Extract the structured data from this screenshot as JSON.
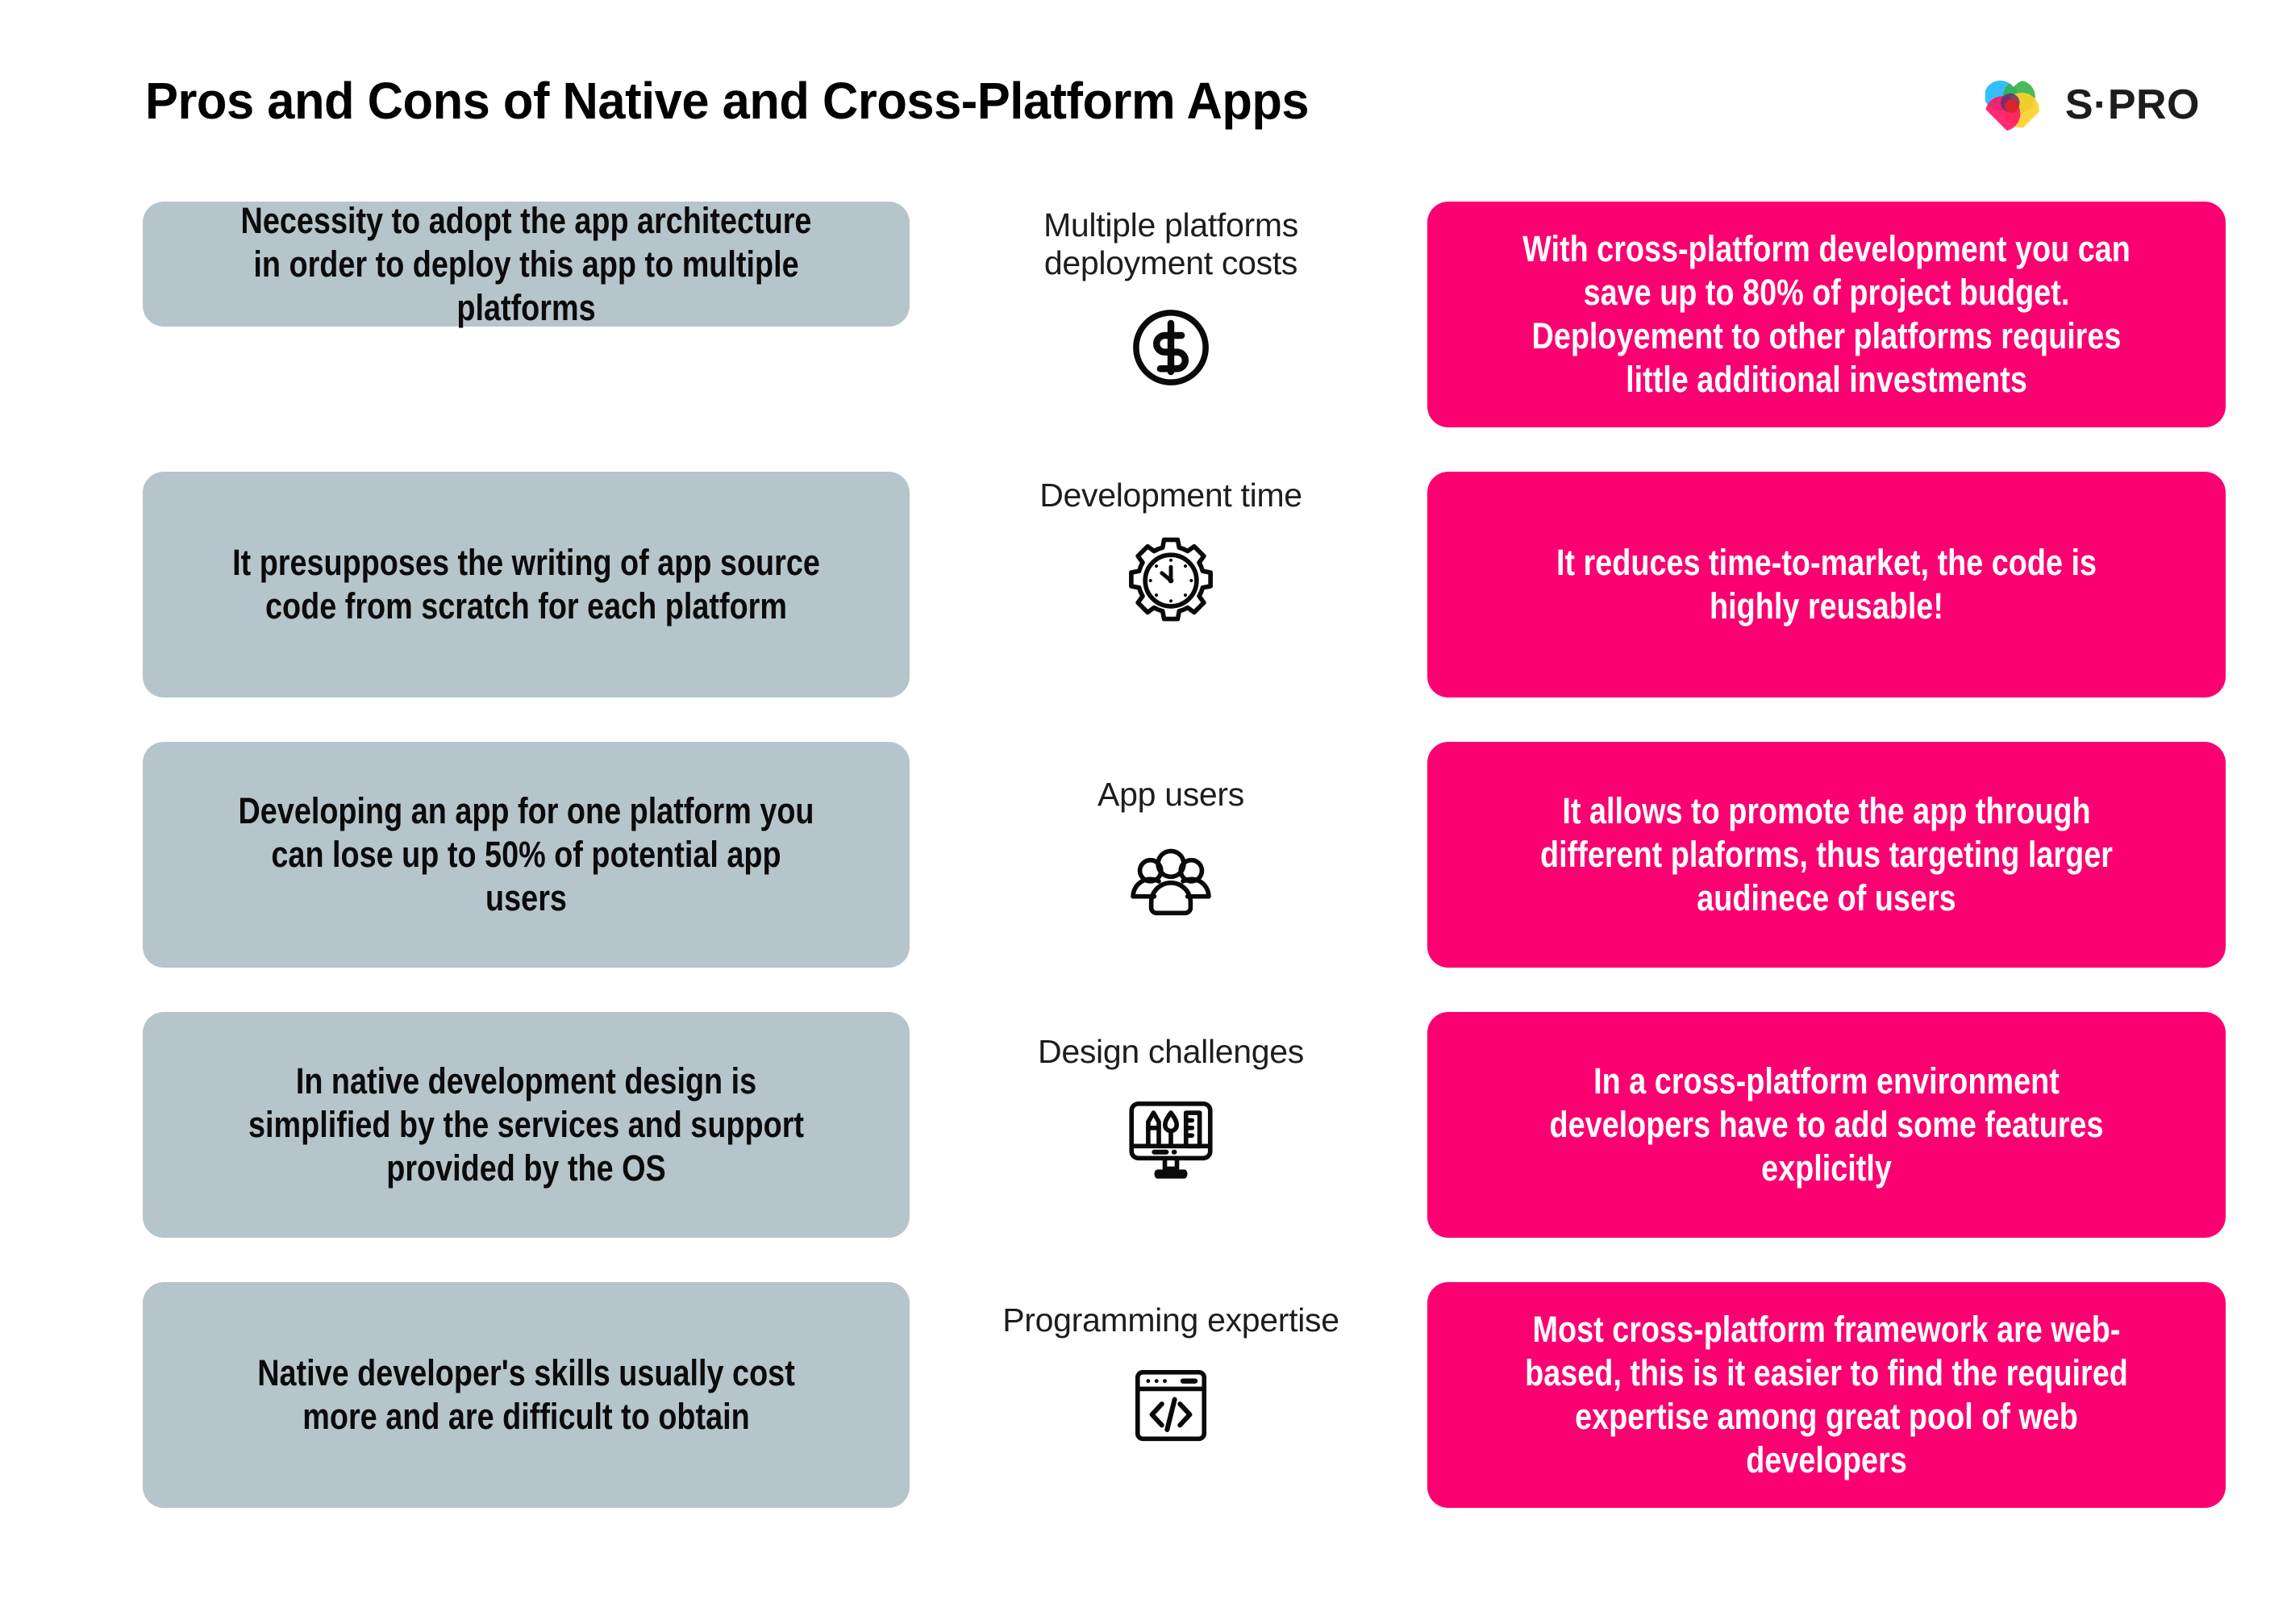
{
  "header": {
    "title": "Pros and Cons of Native and Cross-Platform Apps",
    "brand_name": "S·PRO",
    "brand_logo_icon": "spro-heart-logo-icon"
  },
  "colors": {
    "con_card_bg": "#b6c4cb",
    "pro_card_bg": "#fb0070",
    "pro_card_text": "#ffffff",
    "con_card_text": "#0b0b0b",
    "page_bg": "#ffffff",
    "label_text": "#1d1d1f",
    "logo_cyan": "#35befc",
    "logo_green": "#34b34a",
    "logo_yellow": "#ffd028",
    "logo_pink": "#ff1464"
  },
  "rows": [
    {
      "con": "Necessity to adopt the app architecture in order to deploy this app to multiple platforms",
      "label": "Multiple platforms\ndeployment costs",
      "icon": "dollar-circle-icon",
      "pro": "With cross-platform development you can save up to 80% of project budget. Deployement to other platforms requires little additional investments"
    },
    {
      "con": "It presupposes the writing of app source code from scratch for each platform",
      "label": "Development time",
      "icon": "gear-clock-icon",
      "pro": "It reduces time-to-market, the code is highly reusable!"
    },
    {
      "con": "Developing an app for one platform you can lose up to 50% of potential app users",
      "label": "App users",
      "icon": "users-group-icon",
      "pro": "It allows to promote the app through different plaforms, thus targeting larger audinece of users"
    },
    {
      "con": "In native development design is simplified by the services and support provided by the OS",
      "label": "Design challenges",
      "icon": "monitor-design-tools-icon",
      "pro": "In a cross-platform environment developers have to add some features explicitly"
    },
    {
      "con": "Native developer's skills usually cost more and are difficult to obtain",
      "label": "Programming expertise",
      "icon": "code-window-icon",
      "pro": "Most cross-platform framework are web-based, this is it easier to find the required expertise among great pool of web developers"
    }
  ]
}
